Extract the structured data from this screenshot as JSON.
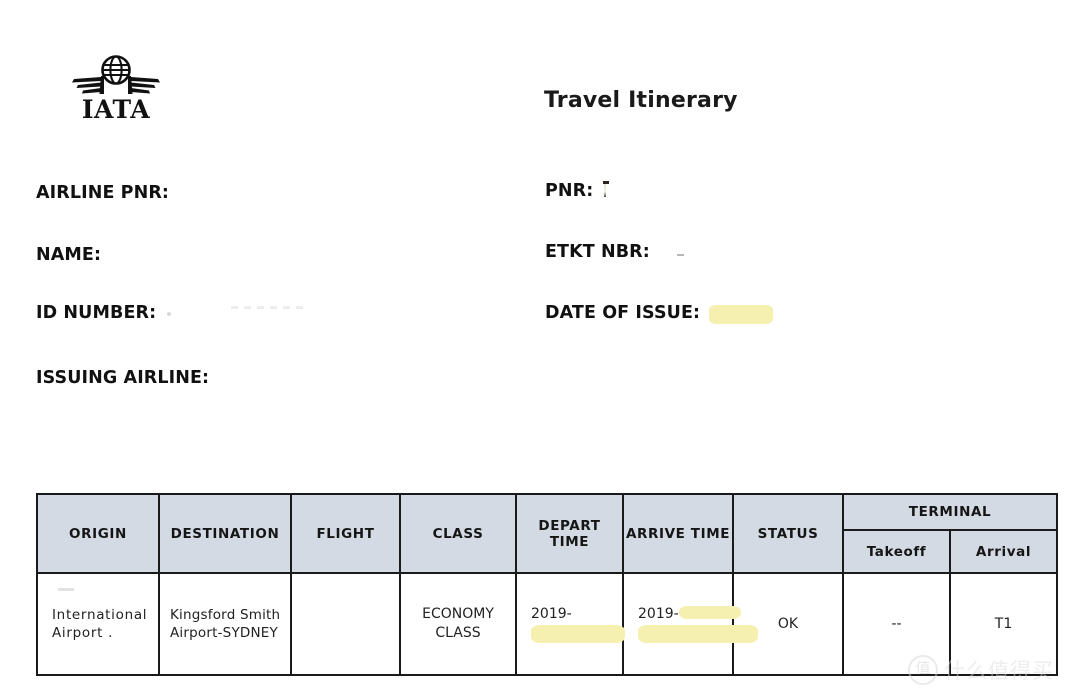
{
  "document": {
    "title": "Travel Itinerary",
    "logo_alt": "IATA",
    "logo_text": "IATA"
  },
  "fields": {
    "rows": [
      {
        "left": {
          "label": "AIRLINE PNR:",
          "value": "",
          "redaction": "blank"
        },
        "right": {
          "label": "PNR:",
          "value": "",
          "redaction": "smudge-pnr"
        }
      },
      {
        "left": {
          "label": "NAME:",
          "value": "",
          "redaction": "blank"
        },
        "right": {
          "label": "ETKT NBR:",
          "value": "",
          "redaction": "smudge-dot"
        }
      },
      {
        "left": {
          "label": "ID NUMBER:",
          "value": "",
          "redaction": "smudge-idnum"
        },
        "right": {
          "label": "DATE OF ISSUE:",
          "value": "",
          "redaction": "highlight"
        }
      },
      {
        "left": {
          "label": "ISSUING AIRLINE:",
          "value": "",
          "redaction": "blank"
        },
        "right": null
      }
    ]
  },
  "table": {
    "headers": {
      "origin": "ORIGIN",
      "destination": "DESTINATION",
      "flight": "FLIGHT",
      "class": "CLASS",
      "depart_time": "DEPART TIME",
      "arrive_time": "ARRIVE TIME",
      "status": "STATUS",
      "terminal_group": "TERMINAL",
      "terminal_takeoff": "Takeoff",
      "terminal_arrival": "Arrival"
    },
    "rows": [
      {
        "origin": "International\nAirport .",
        "origin_line1": "International",
        "origin_line2": "Airport .",
        "destination_line1": "Kingsford Smith",
        "destination_line2": "Airport-SYDNEY",
        "flight": "",
        "class_line1": "ECONOMY",
        "class_line2": "CLASS",
        "depart_time_prefix": "2019-",
        "depart_time_redacted": "",
        "arrive_time_prefix": "2019-",
        "arrive_time_redacted": "",
        "status": "OK",
        "terminal_takeoff": "--",
        "terminal_arrival": "T1"
      }
    ]
  },
  "watermark": {
    "badge": "值",
    "text": "什么值得买"
  },
  "colors": {
    "header_bg": "#d3dae3",
    "border": "#1a1a1a",
    "redaction_highlight": "#f5f0b0",
    "text": "#111111"
  }
}
